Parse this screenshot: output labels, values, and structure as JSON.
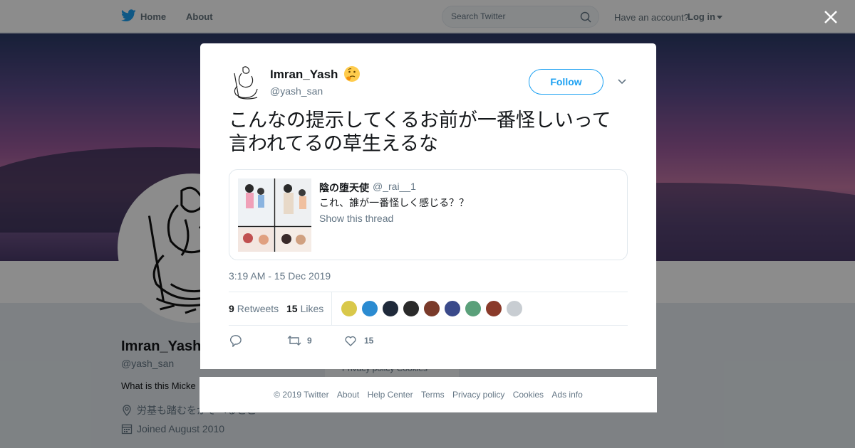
{
  "topbar": {
    "home_label": "Home",
    "about_label": "About",
    "search_placeholder": "Search Twitter",
    "have_account": "Have an account?",
    "login_label": "Log in"
  },
  "profile": {
    "name": "Imran_Yash",
    "handle": "@yash_san",
    "bio": "What is this Micke",
    "location": "労基も踏むをかぞへるとこ",
    "joined": "Joined August 2010",
    "cookies_text": "Privacy policy  Cookies"
  },
  "tweet": {
    "author_name": "Imran_Yash",
    "author_handle": "@yash_san",
    "follow_label": "Follow",
    "text_line1": "こんなの提示してくるお前が一番怪しいって",
    "text_line2": "言われてるの草生えるな",
    "quote": {
      "name": "陰の堕天使",
      "handle": "@_rai__1",
      "text": "これ、誰が一番怪しく感じる？？",
      "show_thread": "Show this thread"
    },
    "timestamp": "3:19 AM - 15 Dec 2019",
    "retweets_count": "9",
    "retweets_label": "Retweets",
    "likes_count": "15",
    "likes_label": "Likes",
    "action_retweets": "9",
    "action_likes": "15",
    "liker_face_colors": [
      "#d9c84a",
      "#2b8bd1",
      "#1f2a3a",
      "#2a2a2a",
      "#7a3a2a",
      "#3a4a8a",
      "#5aa07a",
      "#8a3a2a",
      "#c8cdd2"
    ]
  },
  "footer": {
    "copyright": "© 2019 Twitter",
    "links": [
      "About",
      "Help Center",
      "Terms",
      "Privacy policy",
      "Cookies",
      "Ads info"
    ]
  },
  "colors": {
    "accent": "#1da1f2",
    "muted": "#657786",
    "text": "#14171a"
  }
}
